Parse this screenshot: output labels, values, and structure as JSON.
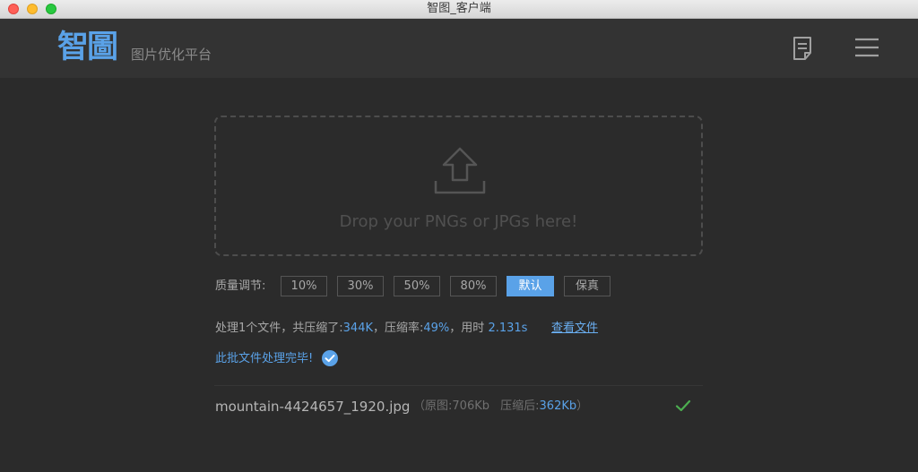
{
  "window": {
    "title": "智图_客户端"
  },
  "header": {
    "logo": "智圖",
    "subtitle": "图片优化平台"
  },
  "dropzone": {
    "text": "Drop your PNGs or JPGs here!"
  },
  "quality": {
    "label": "质量调节:",
    "options": [
      "10%",
      "30%",
      "50%",
      "80%",
      "默认",
      "保真"
    ],
    "selected": "默认"
  },
  "summary": {
    "prefix": "处理1个文件，共压缩了:",
    "saved": "344K",
    "rate_label": "，压缩率:",
    "rate": "49%",
    "time_label": "，用时",
    "time": "2.131s",
    "view_link": "查看文件"
  },
  "done": {
    "text": "此批文件处理完毕!"
  },
  "files": [
    {
      "name": "mountain-4424657_1920.jpg",
      "open": "（",
      "original_label": "原图:",
      "original": "706Kb",
      "compressed_label": "压缩后:",
      "compressed": "362Kb",
      "close": "）"
    }
  ],
  "colors": {
    "accent": "#5aa2e8",
    "success": "#4caf50",
    "background": "#2b2b2b"
  }
}
